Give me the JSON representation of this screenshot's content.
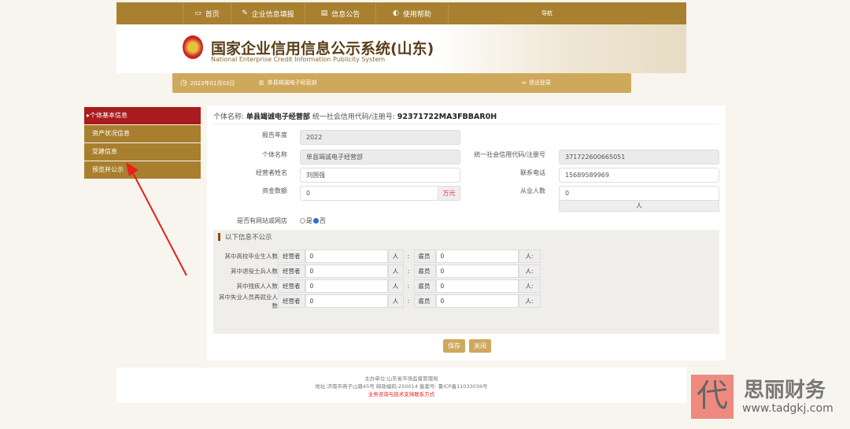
{
  "nav": {
    "items": [
      {
        "label": "首页",
        "icon": "monitor-icon"
      },
      {
        "label": "企业信息填报",
        "icon": "edit-icon"
      },
      {
        "label": "信息公告",
        "icon": "document-icon"
      },
      {
        "label": "使用帮助",
        "icon": "speaker-icon"
      }
    ],
    "nav_label": "导航"
  },
  "header": {
    "title": "国家企业信用信息公示系统(山东)",
    "subtitle": "National Enterprise Credit Information Publicity System"
  },
  "subbar": {
    "date": "2023年01月03日",
    "company": "单县竭诚电子经营部",
    "logout": "退出登录"
  },
  "sidebar": {
    "items": [
      "个体基本信息",
      "资产状况信息",
      "党建信息",
      "预览并公示"
    ],
    "active": 0
  },
  "main": {
    "name_label": "个体名称:",
    "name": "单县竭诚电子经营部",
    "code_label": "统一社会信用代码/注册号:",
    "code": "92371722MA3FBBAR0H",
    "fields": {
      "year_label": "报告年度",
      "year": "2022",
      "entity_label": "个体名称",
      "entity": "单县竭诚电子经营部",
      "uscc_label": "统一社会信用代码/注册号",
      "uscc": "371722600665051",
      "operator_label": "经营者姓名",
      "operator": "刘国强",
      "phone_label": "联系电话",
      "phone": "15689589969",
      "capital_label": "资金数额",
      "capital": "0",
      "capital_unit": "万元",
      "employees_label": "从业人数",
      "employees": "0",
      "employees_unit": "人",
      "website_label": "是否有网站或网店",
      "radio_yes": "是",
      "radio_no": "否",
      "website_value": "否"
    },
    "private_title": "以下信息不公示",
    "rows": [
      {
        "label": "其中高校毕业生人数",
        "op_label": "经营者",
        "op": "0",
        "op_unit": "人",
        "colon": ":",
        "emp_label": "雇员",
        "emp": "0",
        "emp_unit": "人:"
      },
      {
        "label": "其中退役士兵人数",
        "op_label": "经营者",
        "op": "0",
        "op_unit": "人",
        "colon": ":",
        "emp_label": "雇员",
        "emp": "0",
        "emp_unit": "人:"
      },
      {
        "label": "其中残疾人人数",
        "op_label": "经营者",
        "op": "0",
        "op_unit": "人",
        "colon": ":",
        "emp_label": "雇员",
        "emp": "0",
        "emp_unit": "人:"
      },
      {
        "label": "其中失业人员再就业人数",
        "op_label": "经营者",
        "op": "0",
        "op_unit": "人",
        "colon": ":",
        "emp_label": "雇员",
        "emp": "0",
        "emp_unit": "人:"
      }
    ],
    "save": "保存",
    "close": "关闭"
  },
  "footer": {
    "line1": "主办单位:山东省市场监督管理局",
    "line2": "地址:济南市燕子山路45号    邮政编码:250014    备案号: 鲁ICP备11033036号",
    "line3": "业务咨询与技术支持联系方式"
  },
  "watermark": {
    "logo_char": "代",
    "name": "思丽财务",
    "url": "www.tadgkj.com"
  },
  "colors": {
    "gold": "#a98030",
    "light_gold": "#cfa95b",
    "active_red": "#a91b1e",
    "arrow": "#e8201a"
  }
}
